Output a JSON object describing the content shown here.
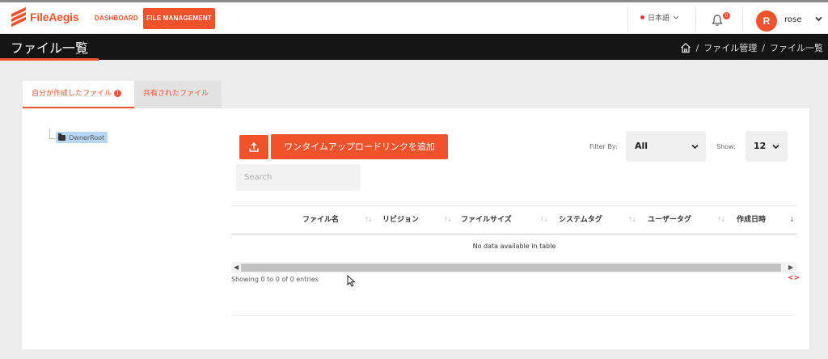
{
  "brand": {
    "name": "FileAegis",
    "color": "#f0532b"
  },
  "nav": {
    "dashboard": "DASHBOARD",
    "file_management": "FILE MANAGEMENT"
  },
  "header": {
    "language": "日本語",
    "notification_count": "0",
    "avatar_initial": "R",
    "username": "rose"
  },
  "page": {
    "title": "ファイル一覧",
    "breadcrumb": [
      "/",
      "ファイル管理",
      "/",
      "ファイル一覧"
    ]
  },
  "tabs": [
    {
      "label": "自分が作成したファイル",
      "active": true
    },
    {
      "label": "共有されたファイル",
      "active": false
    }
  ],
  "tree": {
    "root": "OwnerRoot"
  },
  "toolbar": {
    "add_link": "ワンタイムアップロードリンクを追加",
    "filter_label": "Filter By:",
    "filter_value": "All",
    "show_label": "Show:",
    "show_value": "12",
    "search_placeholder": "Search"
  },
  "table": {
    "columns": [
      "ファイル名",
      "リビジョン",
      "ファイルサイズ",
      "システムタグ",
      "ユーザータグ",
      "作成日時"
    ],
    "empty_message": "No data available in table",
    "info": "Showing 0 to 0 of 0 entries"
  },
  "icons": [
    "home-icon",
    "bell-icon",
    "upload-icon",
    "folder-icon",
    "info-icon",
    "code-icon",
    "chevron-down-icon"
  ]
}
